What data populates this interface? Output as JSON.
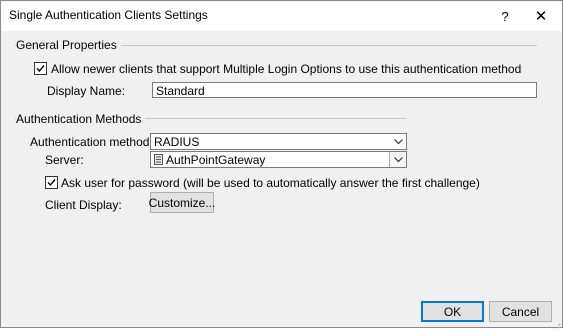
{
  "window": {
    "title": "Single Authentication Clients Settings",
    "help_glyph": "?",
    "close_glyph": "✕"
  },
  "general": {
    "group_label": "General Properties",
    "allow_newer_checkbox": {
      "checked": true,
      "label": "Allow newer clients that support Multiple Login Options to use this authentication method"
    },
    "display_name_label": "Display Name:",
    "display_name_value": "Standard"
  },
  "auth": {
    "group_label": "Authentication Methods",
    "method_label": "Authentication method:",
    "method_value": "RADIUS",
    "server_label": "Server:",
    "server_value": "AuthPointGateway",
    "server_icon": "server-icon",
    "ask_password_checkbox": {
      "checked": true,
      "label": "Ask user for password (will be used to automatically answer the first challenge)"
    },
    "client_display_label": "Client Display:",
    "customize_button": "Customize..."
  },
  "footer": {
    "ok_button": "OK",
    "cancel_button": "Cancel"
  }
}
